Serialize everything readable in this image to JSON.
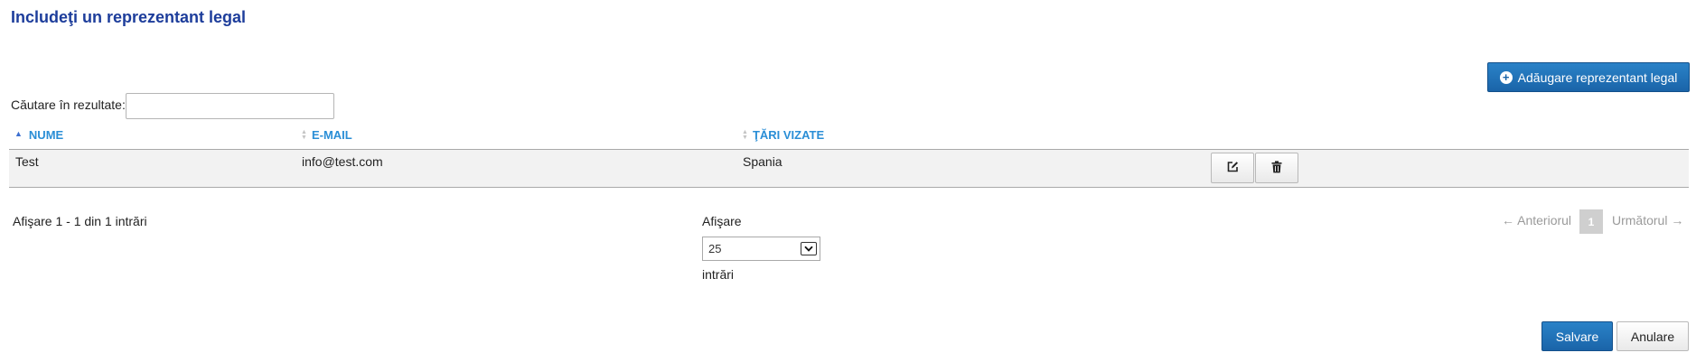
{
  "page": {
    "title": "Includeţi un reprezentant legal"
  },
  "toolbar": {
    "add_label": "Adăugare reprezentant legal",
    "add_icon": "plus-circle-icon"
  },
  "search": {
    "label": "Căutare în rezultate:",
    "value": ""
  },
  "table": {
    "columns": [
      {
        "label": "NUME",
        "sort": "ascending"
      },
      {
        "label": "E-MAIL",
        "sort": "none"
      },
      {
        "label": "ŢĂRI VIZATE",
        "sort": "none"
      }
    ],
    "rows": [
      {
        "name": "Test",
        "email": "info@test.com",
        "countries": "Spania",
        "actions": [
          "edit-icon",
          "trash-icon"
        ]
      }
    ]
  },
  "footer": {
    "info": "Afişare 1 - 1 din 1 intrări",
    "length_label": "Afişare",
    "length_value": "25",
    "length_suffix": "intrări",
    "pager": {
      "prev_label": "← Anteriorul",
      "current_page": "1",
      "next_label": "Următorul →"
    }
  },
  "actions": {
    "save_label": "Salvare",
    "cancel_label": "Anulare"
  },
  "colors": {
    "title": "#1d3d9b",
    "header_link": "#2a8ed6",
    "primary_button": "#1a64a8",
    "row_background": "#f2f2f2"
  }
}
